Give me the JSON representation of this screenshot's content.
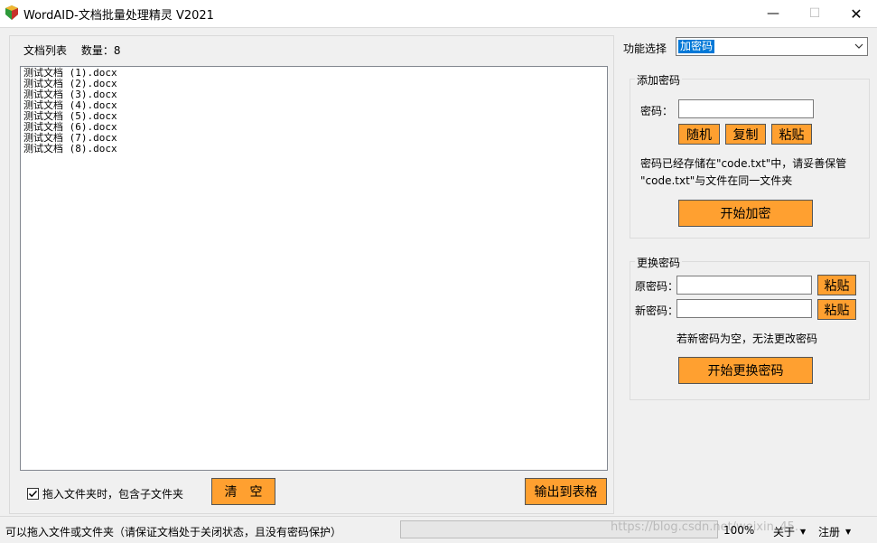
{
  "window": {
    "title": "WordAID-文档批量处理精灵 V2021",
    "controls": {
      "minimize": "—",
      "maximize": "☐",
      "close": "✕"
    }
  },
  "left": {
    "doc_list_label": "文档列表",
    "count_label": "数量：",
    "count_value": "8",
    "files": [
      "测试文档 (1).docx",
      "测试文档 (2).docx",
      "测试文档 (3).docx",
      "测试文档 (4).docx",
      "测试文档 (5).docx",
      "测试文档 (6).docx",
      "测试文档 (7).docx",
      "测试文档 (8).docx"
    ],
    "include_subfolders_label": "拖入文件夹时，包含子文件夹",
    "include_subfolders_checked": true,
    "clear_button": "清　空",
    "export_button": "输出到表格"
  },
  "right": {
    "function_label": "功能选择",
    "function_value": "加密码",
    "add_password": {
      "group_title": "添加密码",
      "password_label": "密码：",
      "password_value": "",
      "random_button": "随机",
      "copy_button": "复制",
      "paste_button": "粘贴",
      "note_line1": "密码已经存储在\"code.txt\"中，请妥善保管",
      "note_line2": "\"code.txt\"与文件在同一文件夹",
      "start_button": "开始加密"
    },
    "change_password": {
      "group_title": "更换密码",
      "old_label": "原密码：",
      "old_value": "",
      "new_label": "新密码：",
      "new_value": "",
      "paste_old_button": "粘贴",
      "paste_new_button": "粘贴",
      "note": "若新密码为空，无法更改密码",
      "start_button": "开始更换密码"
    }
  },
  "statusbar": {
    "message": "可以拖入文件或文件夹（请保证文档处于关闭状态，且没有密码保护）",
    "progress_percent": 0,
    "zoom": "100%",
    "about_label": "关于",
    "register_label": "注册",
    "watermark": "https://blog.csdn.net/weixin_45..."
  },
  "colors": {
    "accent_button": "#ffa030",
    "selection": "#0078d7",
    "progress": "#06b025"
  }
}
